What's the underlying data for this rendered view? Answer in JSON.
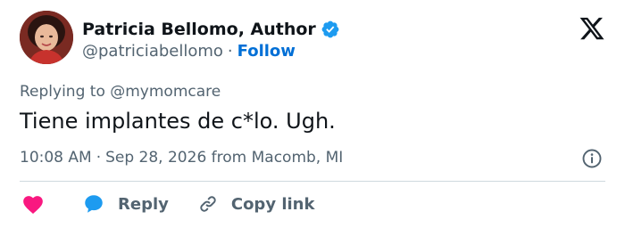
{
  "author": {
    "display_name": "Patricia Bellomo, Author",
    "handle": "@patriciabellomo",
    "separator": "·",
    "follow_label": "Follow",
    "verified": true
  },
  "icons": {
    "verified": "verified-badge-icon",
    "platform": "x-logo-icon",
    "info": "info-icon",
    "like": "heart-icon",
    "reply": "reply-bubble-icon",
    "copy": "link-icon"
  },
  "tweet": {
    "replying_to": "Replying to @mymomcare",
    "text": "Tiene implantes de c*lo. Ugh.",
    "time": "10:08 AM",
    "separator": "·",
    "date_location": "Sep 28, 2026 from Macomb, MI"
  },
  "actions": {
    "reply_label": "Reply",
    "copy_link_label": "Copy link"
  },
  "colors": {
    "text": "#0f1419",
    "muted": "#536471",
    "link": "#006fd6",
    "verified": "#1d9bf0",
    "like": "#f91880",
    "divider": "#cfd9de"
  }
}
